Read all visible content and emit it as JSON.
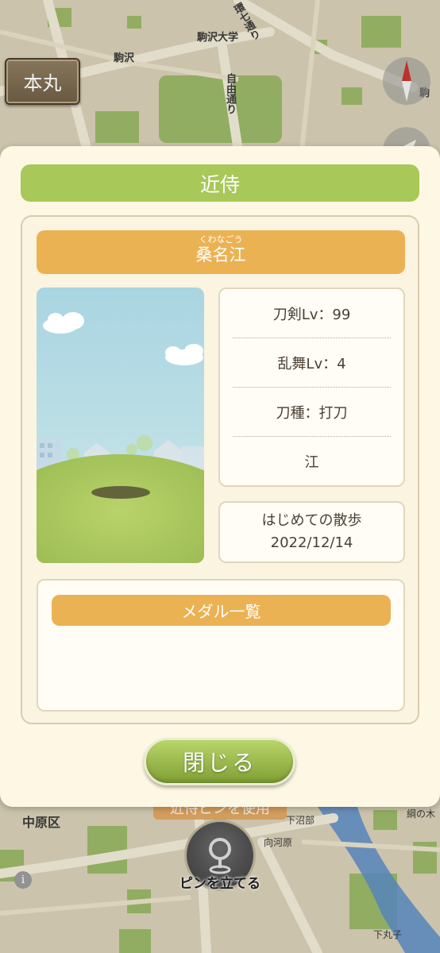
{
  "map": {
    "honmaru_button": "本丸",
    "labels": {
      "komazawa_univ": "駒沢大学",
      "komazawa": "駒沢",
      "kannana": "環七通り",
      "jiyu": "自由通り",
      "nakahara": "中原区",
      "shimonumabe": "下沼部",
      "mukogawara": "向河原",
      "shimomaruko": "下丸子",
      "tsunanoki": "綱の木",
      "koma_edge": "駒"
    },
    "pin_tag": "近侍ピンを使用",
    "pin_button_label": "ピンを立てる",
    "info_icon": "i"
  },
  "modal": {
    "title": "近侍",
    "character": {
      "ruby": "くわなごう",
      "name": "桑名江"
    },
    "stats": [
      "刀剣Lv：99",
      "乱舞Lv：4",
      "刀種：打刀",
      "江"
    ],
    "first_walk": {
      "label": "はじめての散歩",
      "date": "2022/12/14"
    },
    "medal_list_title": "メダル一覧",
    "close_button": "閉じる"
  },
  "colors": {
    "header_green": "#a8c85a",
    "name_orange": "#ebb253",
    "panel_bg": "#fdf7e4"
  }
}
